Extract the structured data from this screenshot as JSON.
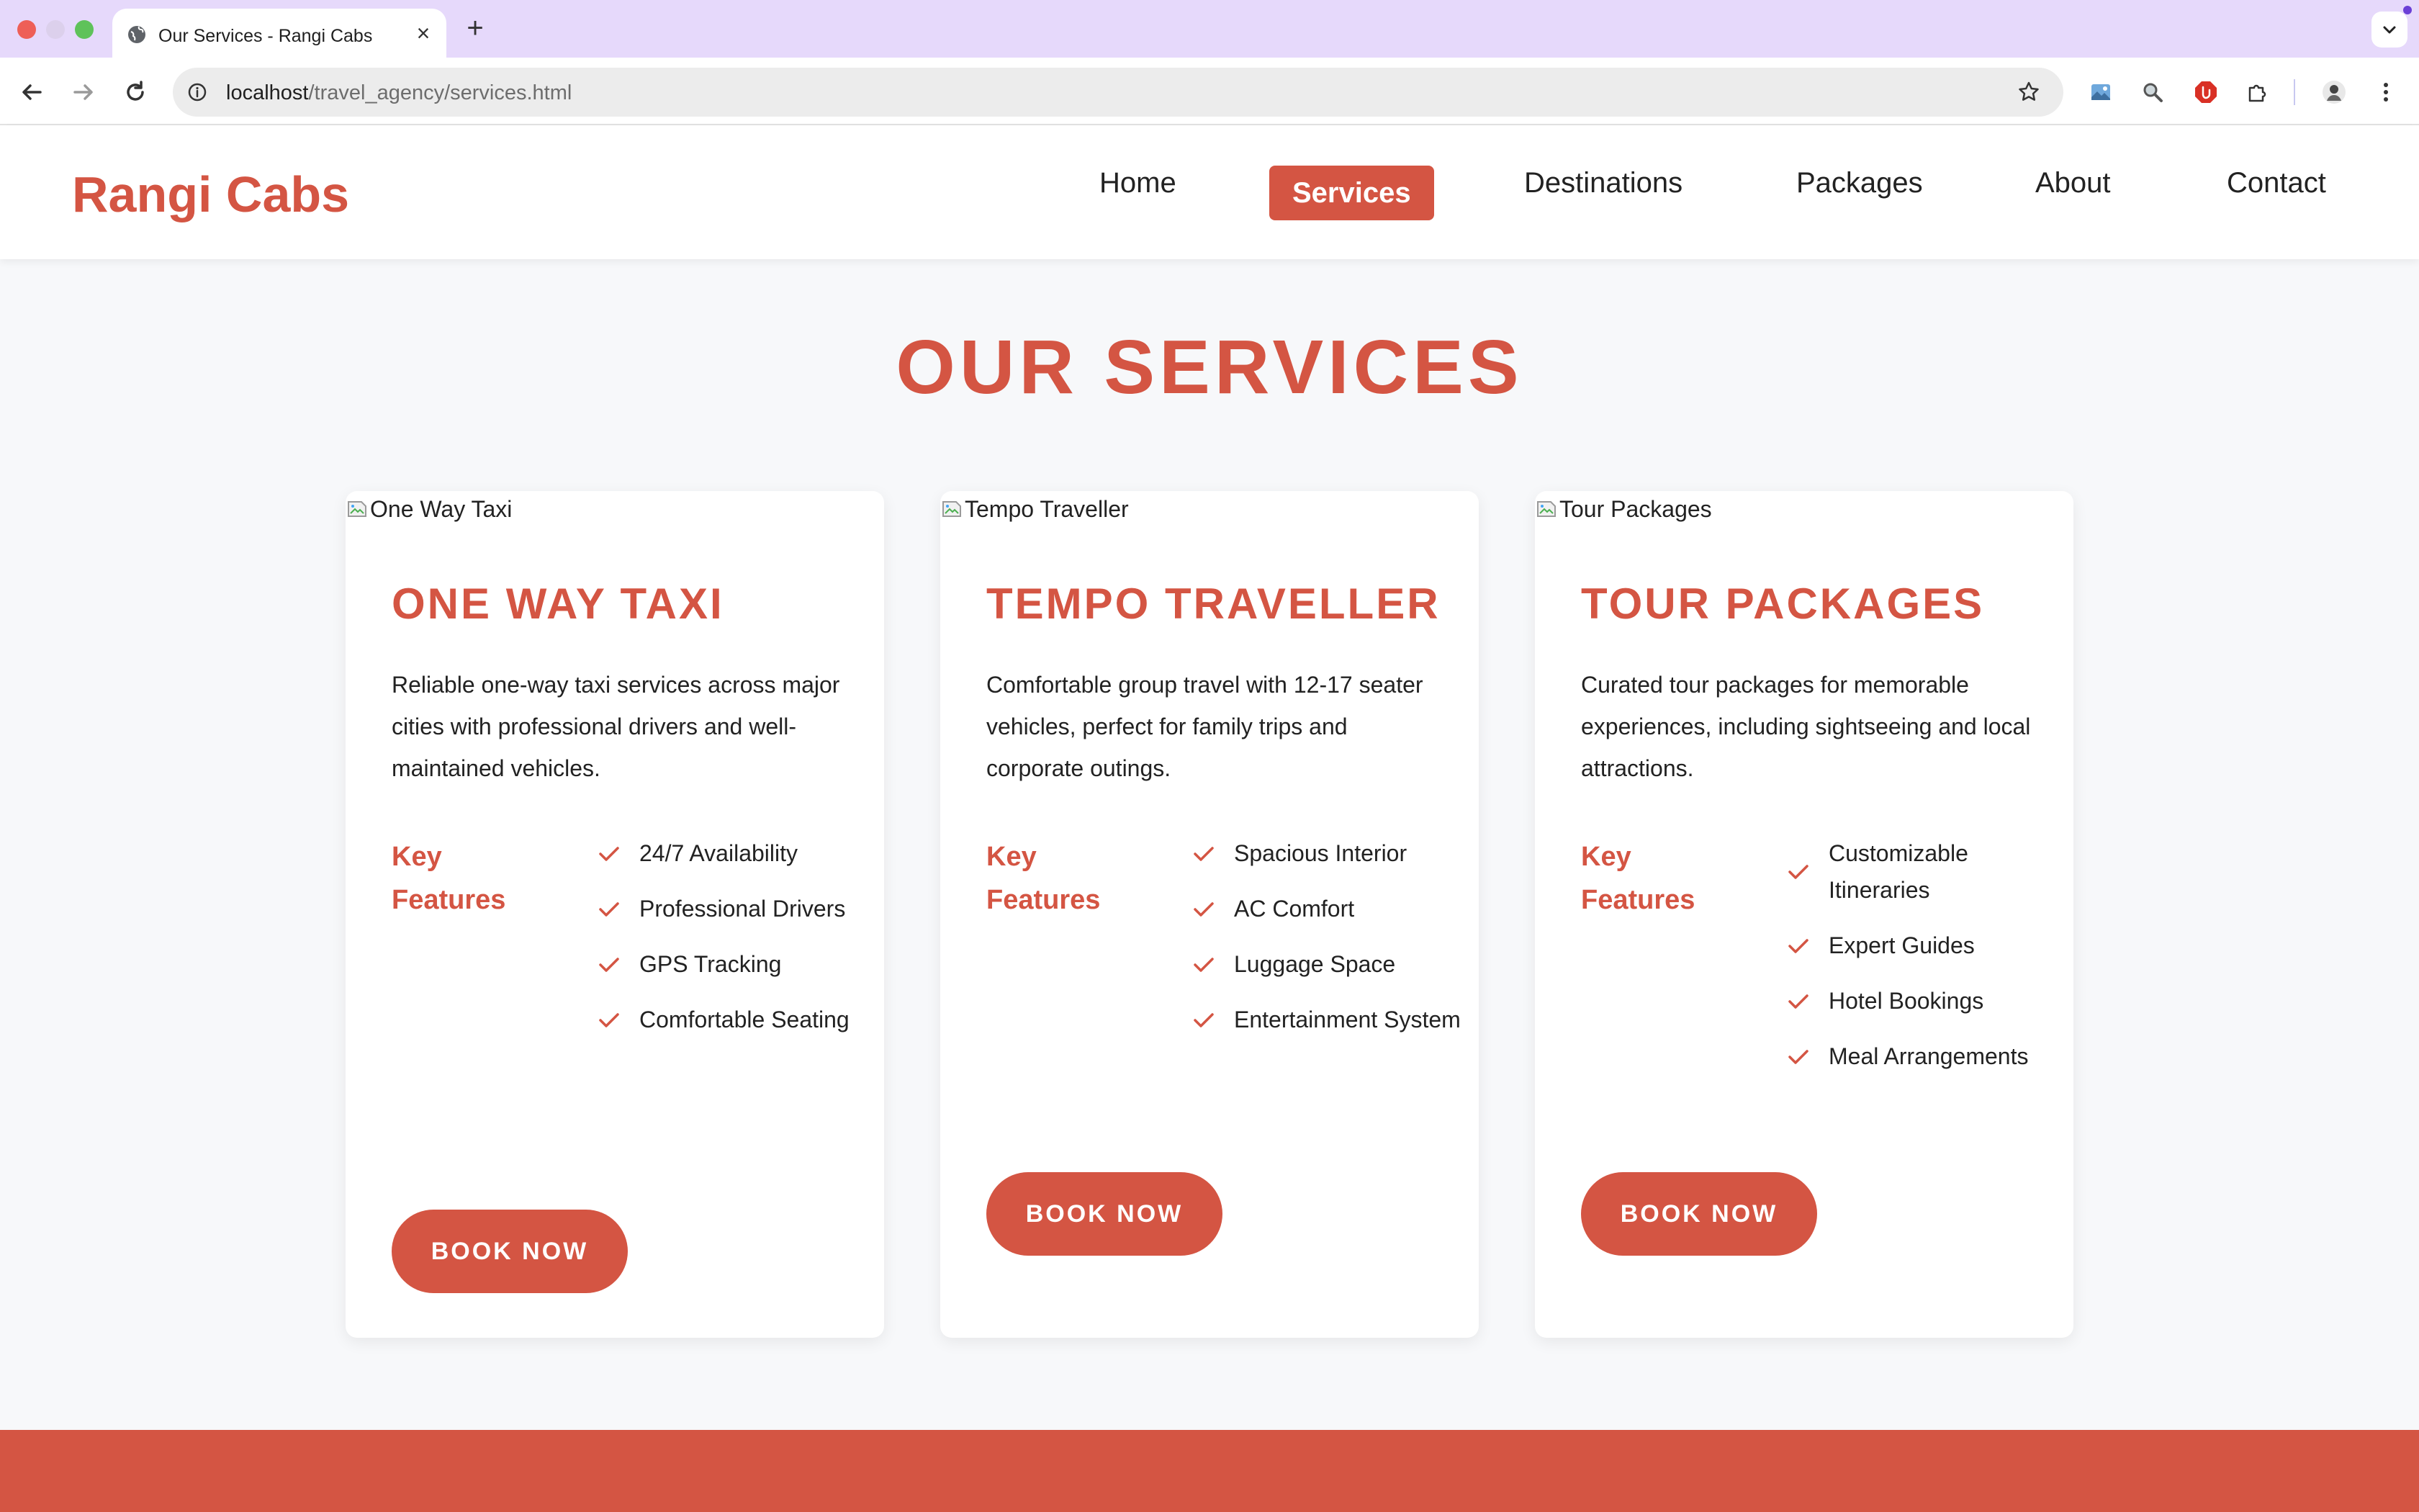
{
  "browser": {
    "tab_title": "Our Services - Rangi Cabs",
    "url_host": "localhost",
    "url_path": "/travel_agency/services.html"
  },
  "site": {
    "logo": "Rangi Cabs",
    "nav": [
      {
        "label": "Home",
        "active": false
      },
      {
        "label": "Services",
        "active": true
      },
      {
        "label": "Destinations",
        "active": false
      },
      {
        "label": "Packages",
        "active": false
      },
      {
        "label": "About",
        "active": false
      },
      {
        "label": "Contact",
        "active": false
      }
    ]
  },
  "page": {
    "title": "OUR SERVICES"
  },
  "cards": [
    {
      "image_alt": "One Way Taxi",
      "title": "ONE WAY TAXI",
      "description": "Reliable one-way taxi services across major cities with professional drivers and well-maintained vehicles.",
      "features_label": "Key Features",
      "features": [
        "24/7 Availability",
        "Professional Drivers",
        "GPS Tracking",
        "Comfortable Seating"
      ],
      "button": "BOOK NOW"
    },
    {
      "image_alt": "Tempo Traveller",
      "title": "TEMPO TRAVELLER",
      "description": "Comfortable group travel with 12-17 seater vehicles, perfect for family trips and corporate outings.",
      "features_label": "Key Features",
      "features": [
        "Spacious Interior",
        "AC Comfort",
        "Luggage Space",
        "Entertainment System"
      ],
      "button": "BOOK NOW"
    },
    {
      "image_alt": "Tour Packages",
      "title": "TOUR PACKAGES",
      "description": "Curated tour packages for memorable experiences, including sightseeing and local attractions.",
      "features_label": "Key Features",
      "features": [
        "Customizable Itineraries",
        "Expert Guides",
        "Hotel Bookings",
        "Meal Arrangements"
      ],
      "button": "BOOK NOW"
    }
  ],
  "colors": {
    "brand": "#d45543",
    "background": "#f7f8fa",
    "tab_strip": "#e6d9fb"
  }
}
